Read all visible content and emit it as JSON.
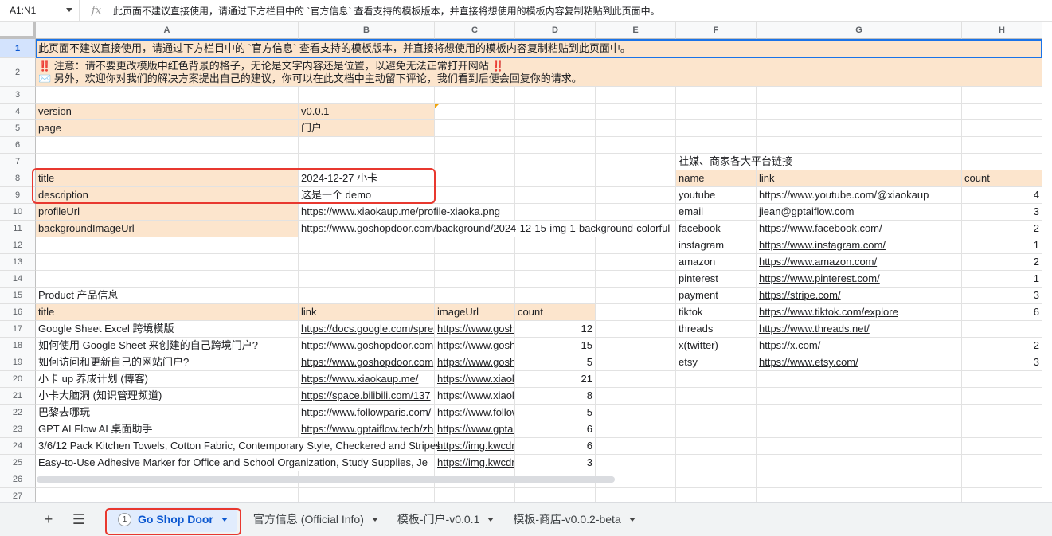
{
  "formula_bar": {
    "cell_ref": "A1:N1",
    "fx": "fx",
    "content": "此页面不建议直接使用，请通过下方栏目中的 `官方信息` 查看支持的模板版本，并直接将想使用的模板内容复制粘贴到此页面中。"
  },
  "columns": [
    "A",
    "B",
    "C",
    "D",
    "E",
    "F",
    "G",
    "H"
  ],
  "rows": [
    "1",
    "2",
    "3",
    "4",
    "5",
    "6",
    "7",
    "8",
    "9",
    "10",
    "11",
    "12",
    "13",
    "14",
    "15",
    "16",
    "17",
    "18",
    "19",
    "20",
    "21",
    "22",
    "23",
    "24",
    "25",
    "26",
    "27"
  ],
  "banner": {
    "row1": "此页面不建议直接使用，请通过下方栏目中的 `官方信息` 查看支持的模板版本，并直接将想使用的模板内容复制粘贴到此页面中。",
    "row2_line1_mark": "‼️",
    "row2_line1": " 注意：请不要更改模版中红色背景的格子，无论是文字内容还是位置，以避免无法正常打开网站 ",
    "row2_line1_end": "‼️",
    "row2_line2": "✉️ 另外，欢迎你对我们的解决方案提出自己的建议，你可以在此文档中主动留下评论，我们看到后便会回复你的请求。"
  },
  "config": [
    {
      "key": "version",
      "value": "v0.0.1"
    },
    {
      "key": "page",
      "value": "门户"
    },
    {
      "key": "title",
      "value": "2024-12-27 小卡"
    },
    {
      "key": "description",
      "value": "这是一个 demo"
    },
    {
      "key": "profileUrl",
      "value": "https://www.xiaokaup.me/profile-xiaoka.png"
    },
    {
      "key": "backgroundImageUrl",
      "value": "https://www.goshopdoor.com/background/2024-12-15-img-1-background-colorful"
    }
  ],
  "products": {
    "section_title": "Product 产品信息",
    "headers": [
      "title",
      "link",
      "imageUrl",
      "count"
    ],
    "rows": [
      {
        "title": "Google Sheet Excel 跨境模版",
        "link": "https://docs.google.com/spreadsheets",
        "image": "https://www.goshopdoor.com",
        "count": "12"
      },
      {
        "title": "如何使用 Google Sheet 来创建的自己跨境门户?",
        "link": "https://www.goshopdoor.com",
        "image": "https://www.goshopdoor.com",
        "count": "15"
      },
      {
        "title": "如何访问和更新自己的网站门户?",
        "link": "https://www.goshopdoor.com",
        "image": "https://www.goshopdoor.com",
        "count": "5"
      },
      {
        "title": "小卡 up 养成计划 (博客)",
        "link": "https://www.xiaokaup.me/",
        "image": "https://www.xiaokaup.me",
        "count": "21"
      },
      {
        "title": "小卡大脑洞 (知识管理频道)",
        "link": "https://space.bilibili.com/137",
        "image": "https://www.xiaokaup.me",
        "count": "8"
      },
      {
        "title": "巴黎去哪玩",
        "link": "https://www.followparis.com/",
        "image": "https://www.followparis.com",
        "count": "5"
      },
      {
        "title": "GPT AI Flow AI 桌面助手",
        "link": "https://www.gptaiflow.tech/zh",
        "image": "https://www.gptaiflow.tech",
        "count": "6"
      },
      {
        "title": "3/6/12 Pack Kitchen Towels, Cotton Fabric, Contemporary Style, Checkered and Stripes",
        "link": "",
        "image": "https://img.kwcdn.com",
        "count": "6"
      },
      {
        "title": "Easy-to-Use Adhesive Marker for Office and School Organization, Study Supplies, Je",
        "link": "",
        "image": "https://img.kwcdn.com",
        "count": "3"
      }
    ]
  },
  "social": {
    "section_title": "社媒、商家各大平台链接",
    "headers": [
      "name",
      "link",
      "count"
    ],
    "rows": [
      {
        "name": "youtube",
        "link": "https://www.youtube.com/@xiaokaup",
        "count": "4",
        "underline": false
      },
      {
        "name": "email",
        "link": "jiean@gptaiflow.com",
        "count": "3",
        "underline": false
      },
      {
        "name": "facebook",
        "link": "https://www.facebook.com/",
        "count": "2",
        "underline": true
      },
      {
        "name": "instagram",
        "link": "https://www.instagram.com/",
        "count": "1",
        "underline": true
      },
      {
        "name": "amazon",
        "link": "https://www.amazon.com/",
        "count": "2",
        "underline": true
      },
      {
        "name": "pinterest",
        "link": "https://www.pinterest.com/",
        "count": "1",
        "underline": true
      },
      {
        "name": "payment",
        "link": "https://stripe.com/",
        "count": "3",
        "underline": true
      },
      {
        "name": "tiktok",
        "link": "https://www.tiktok.com/explore",
        "count": "6",
        "underline": true
      },
      {
        "name": "threads",
        "link": "https://www.threads.net/",
        "count": "",
        "underline": true
      },
      {
        "name": "x(twitter)",
        "link": "https://x.com/",
        "count": "2",
        "underline": true
      },
      {
        "name": "etsy",
        "link": "https://www.etsy.com/",
        "count": "3",
        "underline": true
      }
    ]
  },
  "tabs": {
    "add_icon": "+",
    "menu_icon": "☰",
    "items": [
      {
        "badge": "1",
        "label": "Go Shop Door",
        "active": true
      },
      {
        "label": "官方信息 (Official Info)",
        "active": false
      },
      {
        "label": "模板-门户-v0.0.1",
        "active": false
      },
      {
        "label": "模板-商店-v0.0.2-beta",
        "active": false
      }
    ]
  },
  "icons": {
    "add": "plus-icon",
    "all_sheets": "menu-icon",
    "fx": "function-icon",
    "dropdown": "chevron-down-icon"
  },
  "colors": {
    "protected_cell": "#fce5cd",
    "highlight_outline": "#e8382f",
    "active_tab": "#0b57d0",
    "note_marker": "#222222",
    "comment_marker": "#f0a30a"
  }
}
